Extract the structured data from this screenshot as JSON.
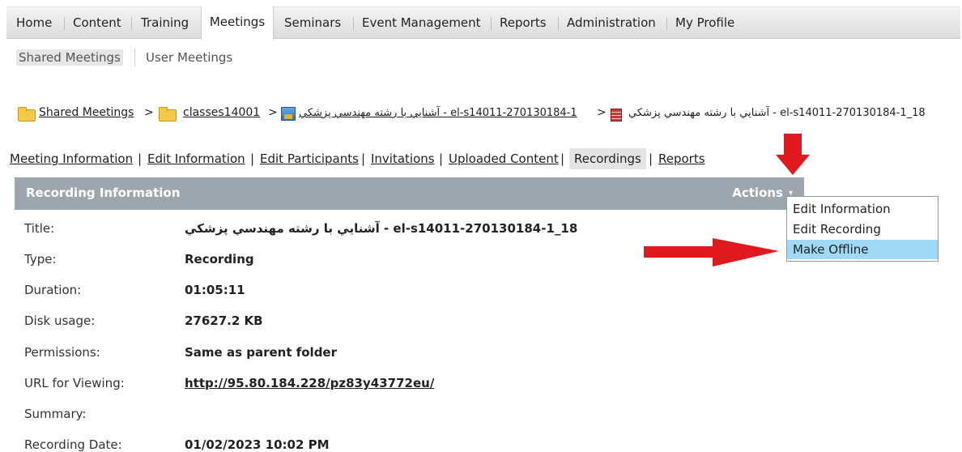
{
  "top_nav": {
    "tabs": [
      {
        "label": "Home"
      },
      {
        "label": "Content"
      },
      {
        "label": "Training"
      },
      {
        "label": "Meetings"
      },
      {
        "label": "Seminars"
      },
      {
        "label": "Event Management"
      },
      {
        "label": "Reports"
      },
      {
        "label": "Administration"
      },
      {
        "label": "My Profile"
      }
    ],
    "active": "Meetings"
  },
  "sub_nav": {
    "items": [
      {
        "label": "Shared Meetings"
      },
      {
        "label": "User Meetings"
      }
    ]
  },
  "breadcrumb": {
    "shared": "Shared Meetings",
    "sep1": ">",
    "classes": "classes14001",
    "sep2": ">",
    "meeting": "آشنايي با رشته مهندسي پزشكي - el-s14011-270130184-1",
    "sep3": ">",
    "current": "آشنايي با رشته مهندسي پزشكي - el-s14011-270130184-1_18"
  },
  "detail_tabs": [
    {
      "label": "Meeting Information"
    },
    {
      "label": "Edit Information"
    },
    {
      "label": "Edit Participants"
    },
    {
      "label": "Invitations"
    },
    {
      "label": "Uploaded Content"
    },
    {
      "label": "Recordings"
    },
    {
      "label": "Reports"
    }
  ],
  "panel": {
    "title": "Recording Information",
    "actions": "Actions",
    "caret": "▾"
  },
  "rows": [
    {
      "label": "Title:",
      "value": "آشنايي با رشته مهندسي پزشكي - el-s14011-270130184-1_18"
    },
    {
      "label": "Type:",
      "value": "Recording"
    },
    {
      "label": "Duration:",
      "value": "01:05:11"
    },
    {
      "label": "Disk usage:",
      "value": "27627.2 KB"
    },
    {
      "label": "Permissions:",
      "value": "Same as parent folder"
    },
    {
      "label": "URL for Viewing:",
      "value": "http://95.80.184.228/pz83y43772eu/"
    },
    {
      "label": "Summary:",
      "value": ""
    },
    {
      "label": "Recording Date:",
      "value": "01/02/2023 10:02 PM"
    }
  ],
  "actions_menu": {
    "items": [
      {
        "label": "Edit Information"
      },
      {
        "label": "Edit Recording"
      },
      {
        "label": "Make Offline"
      }
    ],
    "highlighted": "Make Offline"
  },
  "colors": {
    "panel_header": "#9ea6ad",
    "menu_highlight": "#9fd9f3",
    "annotation_arrow": "#e0191f"
  }
}
